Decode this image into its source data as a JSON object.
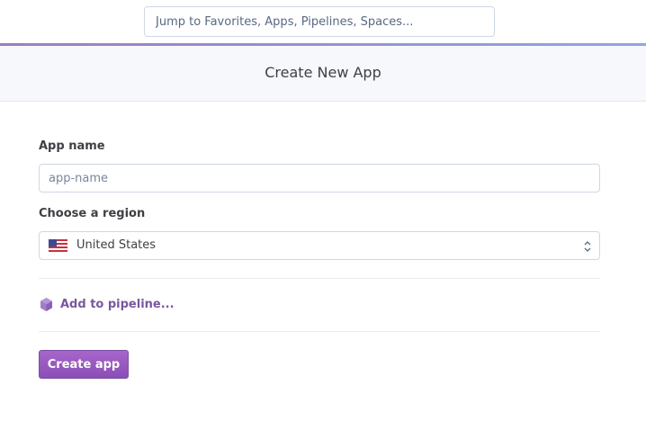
{
  "search": {
    "placeholder": "Jump to Favorites, Apps, Pipelines, Spaces..."
  },
  "header": {
    "title": "Create New App"
  },
  "form": {
    "app_name": {
      "label": "App name",
      "placeholder": "app-name",
      "value": ""
    },
    "region": {
      "label": "Choose a region",
      "selected": "United States",
      "flag_icon": "us-flag-icon"
    },
    "pipeline": {
      "label": "Add to pipeline...",
      "icon": "pipeline-icon"
    },
    "submit": {
      "label": "Create app"
    }
  },
  "colors": {
    "accent_purple": "#79589f",
    "button_top": "#a865c9",
    "button_bottom": "#8a4fb7",
    "header_bg": "#f7f8fb",
    "border": "#cfd7e6"
  }
}
